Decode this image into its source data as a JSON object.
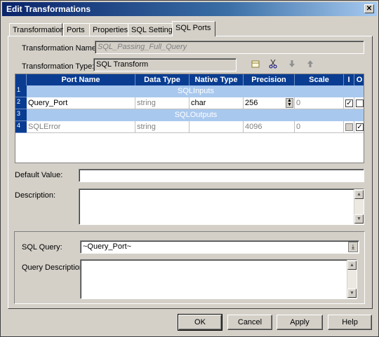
{
  "window": {
    "title": "Edit Transformations",
    "close_glyph": "✕"
  },
  "tabs": [
    {
      "label": "Transformation"
    },
    {
      "label": "Ports"
    },
    {
      "label": "Properties"
    },
    {
      "label": "SQL Settings"
    },
    {
      "label": "SQL Ports",
      "active": true
    }
  ],
  "form": {
    "name_label": "Transformation Name:",
    "name_value": "SQL_Passing_Full_Query",
    "type_label": "Transformation Type:",
    "type_value": "SQL Transform"
  },
  "toolbar_icons": [
    "new-port-icon",
    "cut-icon",
    "move-down-icon",
    "move-up-icon"
  ],
  "grid": {
    "columns": [
      "Port Name",
      "Data Type",
      "Native Type",
      "Precision",
      "Scale",
      "I",
      "O"
    ],
    "rows": [
      {
        "num": "1",
        "group": "SQLInputs"
      },
      {
        "num": "2",
        "port": "Query_Port",
        "datatype": "string",
        "native": "char",
        "precision": "256",
        "scale": "0",
        "input": true,
        "output": false,
        "input_enabled": true
      },
      {
        "num": "3",
        "group": "SQLOutputs"
      },
      {
        "num": "4",
        "port": "SQLError",
        "datatype": "string",
        "native": "",
        "precision": "4096",
        "scale": "0",
        "input": false,
        "output": true,
        "input_enabled": false
      }
    ]
  },
  "default_value": {
    "label": "Default Value:",
    "value": ""
  },
  "description": {
    "label": "Description:",
    "value": ""
  },
  "sql": {
    "query_label": "SQL Query:",
    "query_value": "~Query_Port~",
    "qdesc_label": "Query Description:",
    "qdesc_value": ""
  },
  "buttons": {
    "ok": "OK",
    "cancel": "Cancel",
    "apply": "Apply",
    "help": "Help"
  },
  "colors": {
    "title_bar": "#0a246a",
    "grid_header": "#0a3d91",
    "group_row": "#a9c8ee",
    "dialog_bg": "#d4d0c8"
  }
}
